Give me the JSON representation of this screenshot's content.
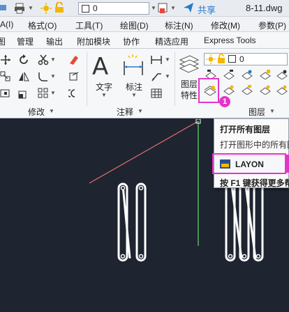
{
  "quick_access": {
    "layer_value": "0",
    "share_label": "共享",
    "file_name": "8-11.dwg"
  },
  "menu": {
    "items": [
      "A(I)",
      "格式(O)",
      "工具(T)",
      "绘图(D)",
      "标注(N)",
      "修改(M)",
      "参数(P)"
    ]
  },
  "tabs": {
    "items": [
      "图",
      "管理",
      "输出",
      "附加模块",
      "协作",
      "精选应用",
      "Express Tools"
    ]
  },
  "ribbon": {
    "modify_panel_label": "修改",
    "annotation_panel_label": "注释",
    "layers_panel_label": "图层",
    "text_button_label": "文字",
    "dimension_button_label": "标注",
    "layer_properties_label_line1": "图层",
    "layer_properties_label_line2": "特性",
    "layer_combo_value": "0",
    "step_badge": "1"
  },
  "flyout": {
    "title": "打开所有图层",
    "description": "打开图形中的所有图",
    "command": "LAYON",
    "help_hint": "按 F1 键获得更多帮"
  },
  "colors": {
    "highlight": "#e535c8",
    "canvas_bg": "#1e2430",
    "share_blue": "#2a79c9"
  }
}
